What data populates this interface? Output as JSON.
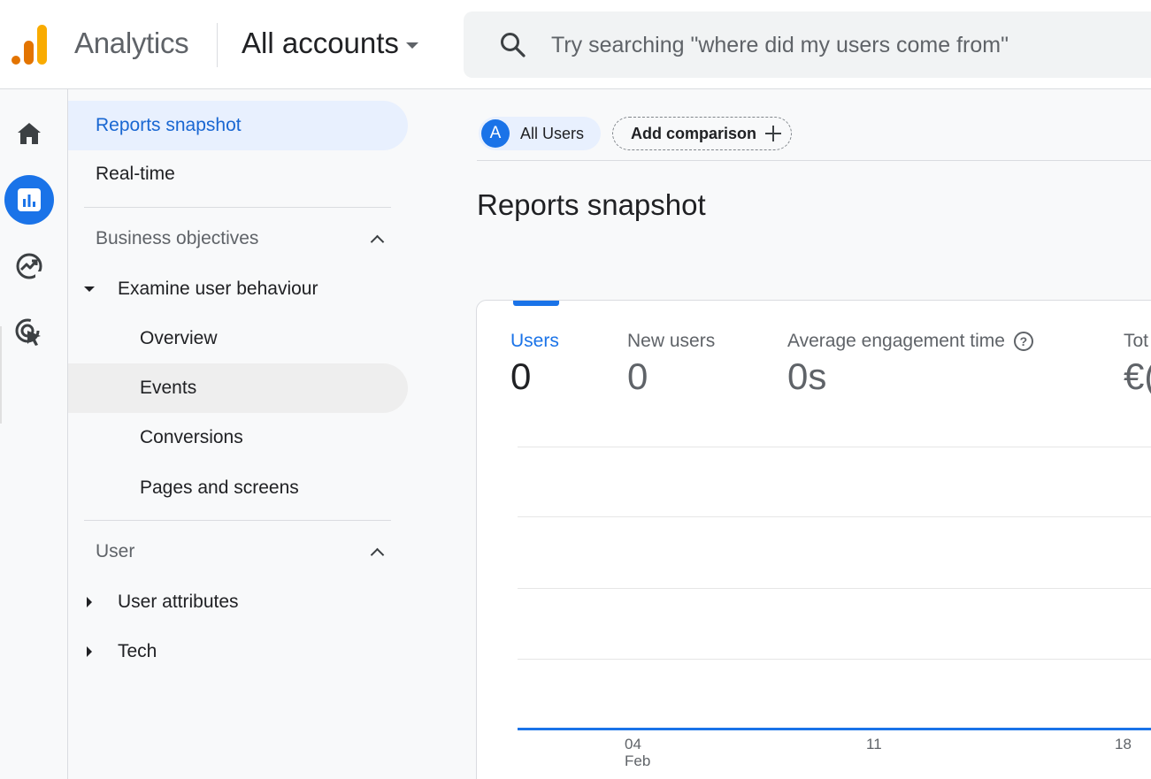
{
  "header": {
    "app_title": "Analytics",
    "account_selector": "All accounts",
    "search_placeholder": "Try searching \"where did my users come from\""
  },
  "rail": {
    "items": [
      {
        "name": "home-icon"
      },
      {
        "name": "reports-icon",
        "active": true
      },
      {
        "name": "explore-icon"
      },
      {
        "name": "advertising-icon"
      }
    ]
  },
  "nav": {
    "reports_snapshot": "Reports snapshot",
    "realtime": "Real-time",
    "section_business": "Business objectives",
    "group_examine": "Examine user behaviour",
    "overview": "Overview",
    "events": "Events",
    "conversions": "Conversions",
    "pages_screens": "Pages and screens",
    "section_user": "User",
    "user_attributes": "User attributes",
    "tech": "Tech"
  },
  "main": {
    "chip_user_avatar": "A",
    "chip_user_label": "All Users",
    "add_comparison": "Add comparison",
    "page_title": "Reports snapshot"
  },
  "metrics": [
    {
      "label": "Users",
      "value": "0"
    },
    {
      "label": "New users",
      "value": "0"
    },
    {
      "label": "Average engagement time",
      "value": "0s"
    },
    {
      "label": "Tot",
      "value": "€("
    }
  ],
  "chart_data": {
    "type": "line",
    "x": [
      "04 Feb",
      "11",
      "18"
    ],
    "series": [
      {
        "values": [
          0,
          0,
          0
        ]
      }
    ],
    "x_ticks": [
      {
        "day": "04",
        "month": "Feb"
      },
      {
        "day": "11",
        "month": ""
      },
      {
        "day": "18",
        "month": ""
      }
    ],
    "grid": true
  },
  "colors": {
    "accent": "#1a73e8",
    "logo_orange": "#F9AB00",
    "logo_dark_orange": "#E37400"
  }
}
